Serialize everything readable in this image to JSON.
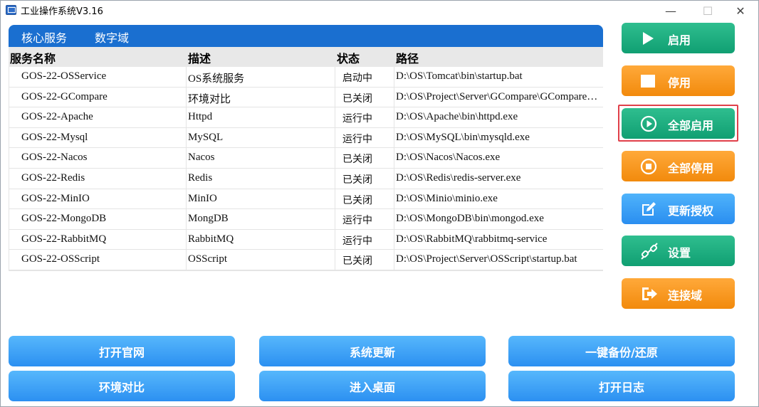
{
  "window": {
    "title": "工业操作系统V3.16",
    "minimize": "—",
    "maximize": "☐",
    "close": "✕"
  },
  "tabs": [
    {
      "label": "核心服务"
    },
    {
      "label": "数字域"
    }
  ],
  "table": {
    "columns": [
      "服务名称",
      "描述",
      "状态",
      "路径"
    ],
    "rows": [
      {
        "name": "GOS-22-OSService",
        "desc": "OS系统服务",
        "status": "启动中",
        "path": "D:\\OS\\Tomcat\\bin\\startup.bat"
      },
      {
        "name": "GOS-22-GCompare",
        "desc": "环境对比",
        "status": "已关闭",
        "path": "D:\\OS\\Project\\Server\\GCompare\\GCompare\\GCompare.exe"
      },
      {
        "name": "GOS-22-Apache",
        "desc": "Httpd",
        "status": "运行中",
        "path": "D:\\OS\\Apache\\bin\\httpd.exe"
      },
      {
        "name": "GOS-22-Mysql",
        "desc": "MySQL",
        "status": "运行中",
        "path": "D:\\OS\\MySQL\\bin\\mysqld.exe"
      },
      {
        "name": "GOS-22-Nacos",
        "desc": "Nacos",
        "status": "已关闭",
        "path": "D:\\OS\\Nacos\\Nacos.exe"
      },
      {
        "name": "GOS-22-Redis",
        "desc": "Redis",
        "status": "已关闭",
        "path": "D:\\OS\\Redis\\redis-server.exe"
      },
      {
        "name": "GOS-22-MinIO",
        "desc": "MinIO",
        "status": "已关闭",
        "path": "D:\\OS\\Minio\\minio.exe"
      },
      {
        "name": "GOS-22-MongoDB",
        "desc": "MongDB",
        "status": "运行中",
        "path": "D:\\OS\\MongoDB\\bin\\mongod.exe"
      },
      {
        "name": "GOS-22-RabbitMQ",
        "desc": "RabbitMQ",
        "status": "运行中",
        "path": "D:\\OS\\RabbitMQ\\rabbitmq-service"
      },
      {
        "name": "GOS-22-OSScript",
        "desc": "OSScript",
        "status": "已关闭",
        "path": "D:\\OS\\Project\\Server\\OSScript\\startup.bat"
      }
    ]
  },
  "side_buttons": {
    "start": "启用",
    "stop": "停用",
    "start_all": "全部启用",
    "stop_all": "全部停用",
    "update_license": "更新授权",
    "settings": "设置",
    "connect_domain": "连接域"
  },
  "bottom_buttons": {
    "open_site": "打开官网",
    "system_update": "系统更新",
    "backup_restore": "一键备份/还原",
    "env_compare": "环境对比",
    "enter_desktop": "进入桌面",
    "open_log": "打开日志"
  },
  "colors": {
    "tab_blue": "#1a6fd0",
    "green": "#17a87a",
    "orange": "#f5960f",
    "blue": "#3aa0f5",
    "highlight_red": "#e0404a"
  }
}
